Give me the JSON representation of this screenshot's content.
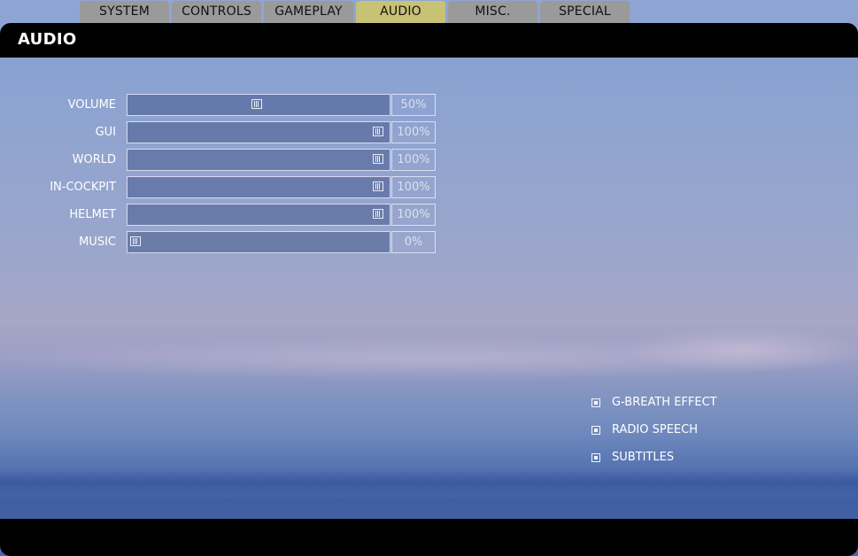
{
  "tabs": [
    {
      "label": "SYSTEM",
      "active": false
    },
    {
      "label": "CONTROLS",
      "active": false
    },
    {
      "label": "GAMEPLAY",
      "active": false
    },
    {
      "label": "AUDIO",
      "active": true
    },
    {
      "label": "MISC.",
      "active": false
    },
    {
      "label": "SPECIAL",
      "active": false
    }
  ],
  "header": {
    "title": "AUDIO"
  },
  "sliders": [
    {
      "label": "VOLUME",
      "value_text": "50%",
      "value": 0.5
    },
    {
      "label": "GUI",
      "value_text": "100%",
      "value": 1.0
    },
    {
      "label": "WORLD",
      "value_text": "100%",
      "value": 1.0
    },
    {
      "label": "IN-COCKPIT",
      "value_text": "100%",
      "value": 1.0
    },
    {
      "label": "HELMET",
      "value_text": "100%",
      "value": 1.0
    },
    {
      "label": "MUSIC",
      "value_text": "0%",
      "value": 0.0
    }
  ],
  "checkboxes": [
    {
      "label": "G-BREATH EFFECT",
      "checked": true
    },
    {
      "label": "RADIO SPEECH",
      "checked": true
    },
    {
      "label": "SUBTITLES",
      "checked": true
    }
  ],
  "colors": {
    "active_tab": "#c8c274",
    "inactive_tab": "#9a9a9a",
    "panel_bar": "#000000"
  }
}
